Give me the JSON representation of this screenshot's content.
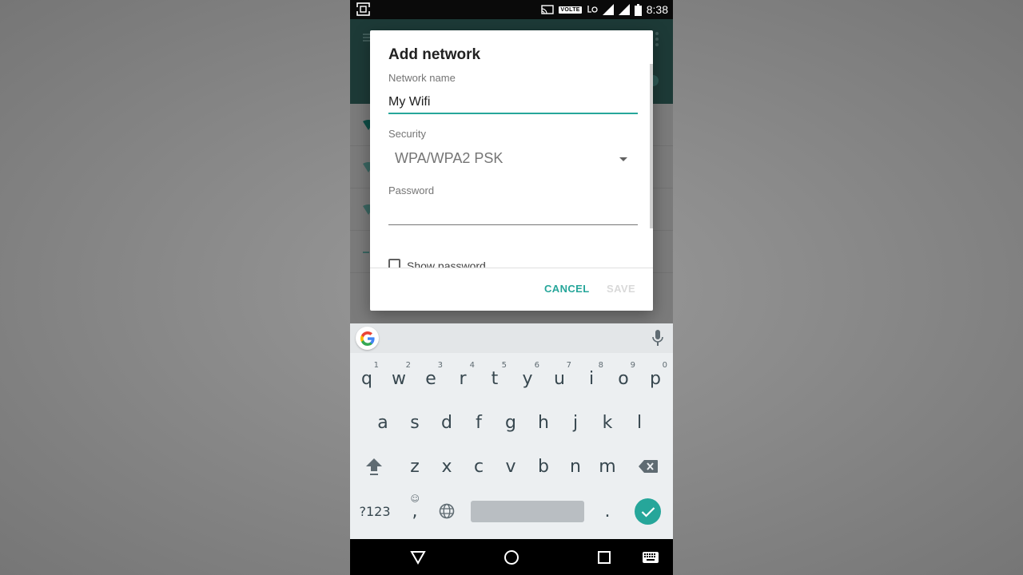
{
  "status_bar": {
    "time": "8:38",
    "volte_label": "VOLTE",
    "icons": [
      "screenshot-icon",
      "cast-icon",
      "volte-badge",
      "lte-icon",
      "signal-icon",
      "signal-icon-2",
      "battery-icon"
    ]
  },
  "dialog": {
    "title": "Add network",
    "network_name_label": "Network name",
    "network_name_value": "My Wifi",
    "security_label": "Security",
    "security_value": "WPA/WPA2 PSK",
    "password_label": "Password",
    "password_value": "",
    "show_password_label": "Show password",
    "show_password_checked": false,
    "cancel_label": "CANCEL",
    "save_label": "SAVE"
  },
  "keyboard": {
    "row1": [
      {
        "letter": "q",
        "hint": "1"
      },
      {
        "letter": "w",
        "hint": "2"
      },
      {
        "letter": "e",
        "hint": "3"
      },
      {
        "letter": "r",
        "hint": "4"
      },
      {
        "letter": "t",
        "hint": "5"
      },
      {
        "letter": "y",
        "hint": "6"
      },
      {
        "letter": "u",
        "hint": "7"
      },
      {
        "letter": "i",
        "hint": "8"
      },
      {
        "letter": "o",
        "hint": "9"
      },
      {
        "letter": "p",
        "hint": "0"
      }
    ],
    "row2": [
      "a",
      "s",
      "d",
      "f",
      "g",
      "h",
      "j",
      "k",
      "l"
    ],
    "row3": [
      "z",
      "x",
      "c",
      "v",
      "b",
      "n",
      "m"
    ],
    "symbols_label": "?123",
    "comma_label": ",",
    "emoji_hint": "☺",
    "period_label": "."
  },
  "colors": {
    "accent": "#26a69a",
    "save_disabled": "#d9d9d9",
    "status_bar": "#0a0a0a",
    "keyboard_bg": "#eceff1"
  }
}
